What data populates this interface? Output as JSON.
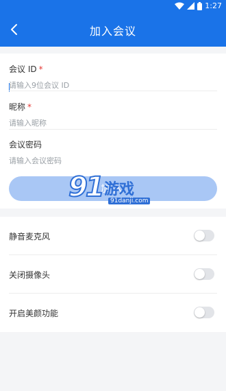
{
  "status_bar": {
    "time": "1:27",
    "icons": [
      "wifi-icon",
      "signal-icon",
      "battery-icon"
    ]
  },
  "header": {
    "title": "加入会议",
    "back_icon": "back-arrow-icon"
  },
  "form": {
    "meeting_id": {
      "label": "会议 ID",
      "required_mark": "*",
      "placeholder": "请输入9位会议 ID",
      "value": ""
    },
    "nickname": {
      "label": "昵称",
      "required_mark": "*",
      "placeholder": "请输入昵称",
      "value": ""
    },
    "password": {
      "label": "会议密码",
      "placeholder": "请输入会议密码",
      "value": ""
    }
  },
  "join_button": {
    "label": "加入"
  },
  "watermark": {
    "logo": "91",
    "text": "游戏",
    "url": "91danji.com"
  },
  "settings": [
    {
      "label": "静音麦克风",
      "enabled": false
    },
    {
      "label": "关闭摄像头",
      "enabled": false
    },
    {
      "label": "开启美颜功能",
      "enabled": false
    }
  ],
  "colors": {
    "primary": "#1a73e8",
    "button_disabled": "#a9c7f5",
    "required": "#e53935",
    "toggle_off": "#e2e4e8"
  }
}
